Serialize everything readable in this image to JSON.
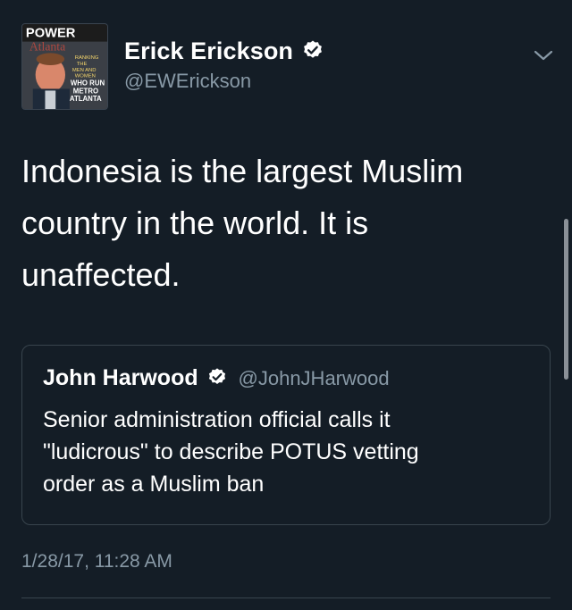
{
  "tweet": {
    "author": {
      "display_name": "Erick Erickson",
      "handle": "@EWErickson",
      "verified": true,
      "avatar_icon": "magazine-cover-avatar",
      "avatar_text": {
        "masthead": "POWER",
        "sub": "Atlanta",
        "lines": [
          "RANKING",
          "THE",
          "MEN AND",
          "WOMEN",
          "WHO RUN",
          "METRO",
          "ATLANTA"
        ]
      }
    },
    "menu_icon": "chevron-down-icon",
    "text_lines": [
      "Indonesia is the largest Muslim",
      "country in the world. It is",
      "unaffected."
    ],
    "quoted": {
      "display_name": "John Harwood",
      "handle": "@JohnJHarwood",
      "verified": true,
      "text_lines": [
        "Senior administration official calls it",
        "\"ludicrous\" to describe POTUS vetting",
        "order as a Muslim ban"
      ]
    },
    "timestamp": "1/28/17, 11:28 AM"
  },
  "colors": {
    "background": "#141d26",
    "text": "#ffffff",
    "secondary_text": "#8899a6",
    "border": "#38444d",
    "verified_badge": "#ffffff"
  }
}
